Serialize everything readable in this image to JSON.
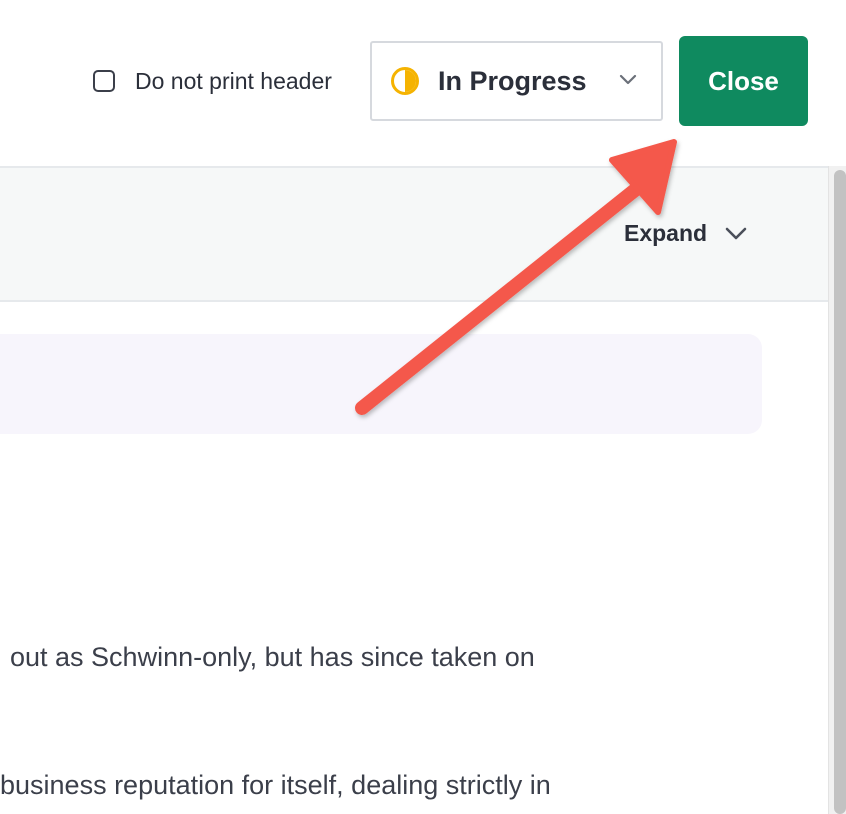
{
  "header": {
    "print_toggle_label": "Do not print header",
    "print_toggle_checked": false,
    "status": {
      "label": "In Progress",
      "icon": "half-circle-icon",
      "icon_color": "#f5b301"
    },
    "close_label": "Close",
    "close_color": "#0f8a5f"
  },
  "section": {
    "expand_label": "Expand",
    "expand_icon": "chevron-down-icon"
  },
  "content": {
    "paragraphs": [
      "out as Schwinn-only, but has since taken on",
      "business reputation for itself, dealing strictly in"
    ]
  },
  "annotation": {
    "arrow_color": "#f4594b",
    "arrow_icon": "arrow-icon"
  }
}
